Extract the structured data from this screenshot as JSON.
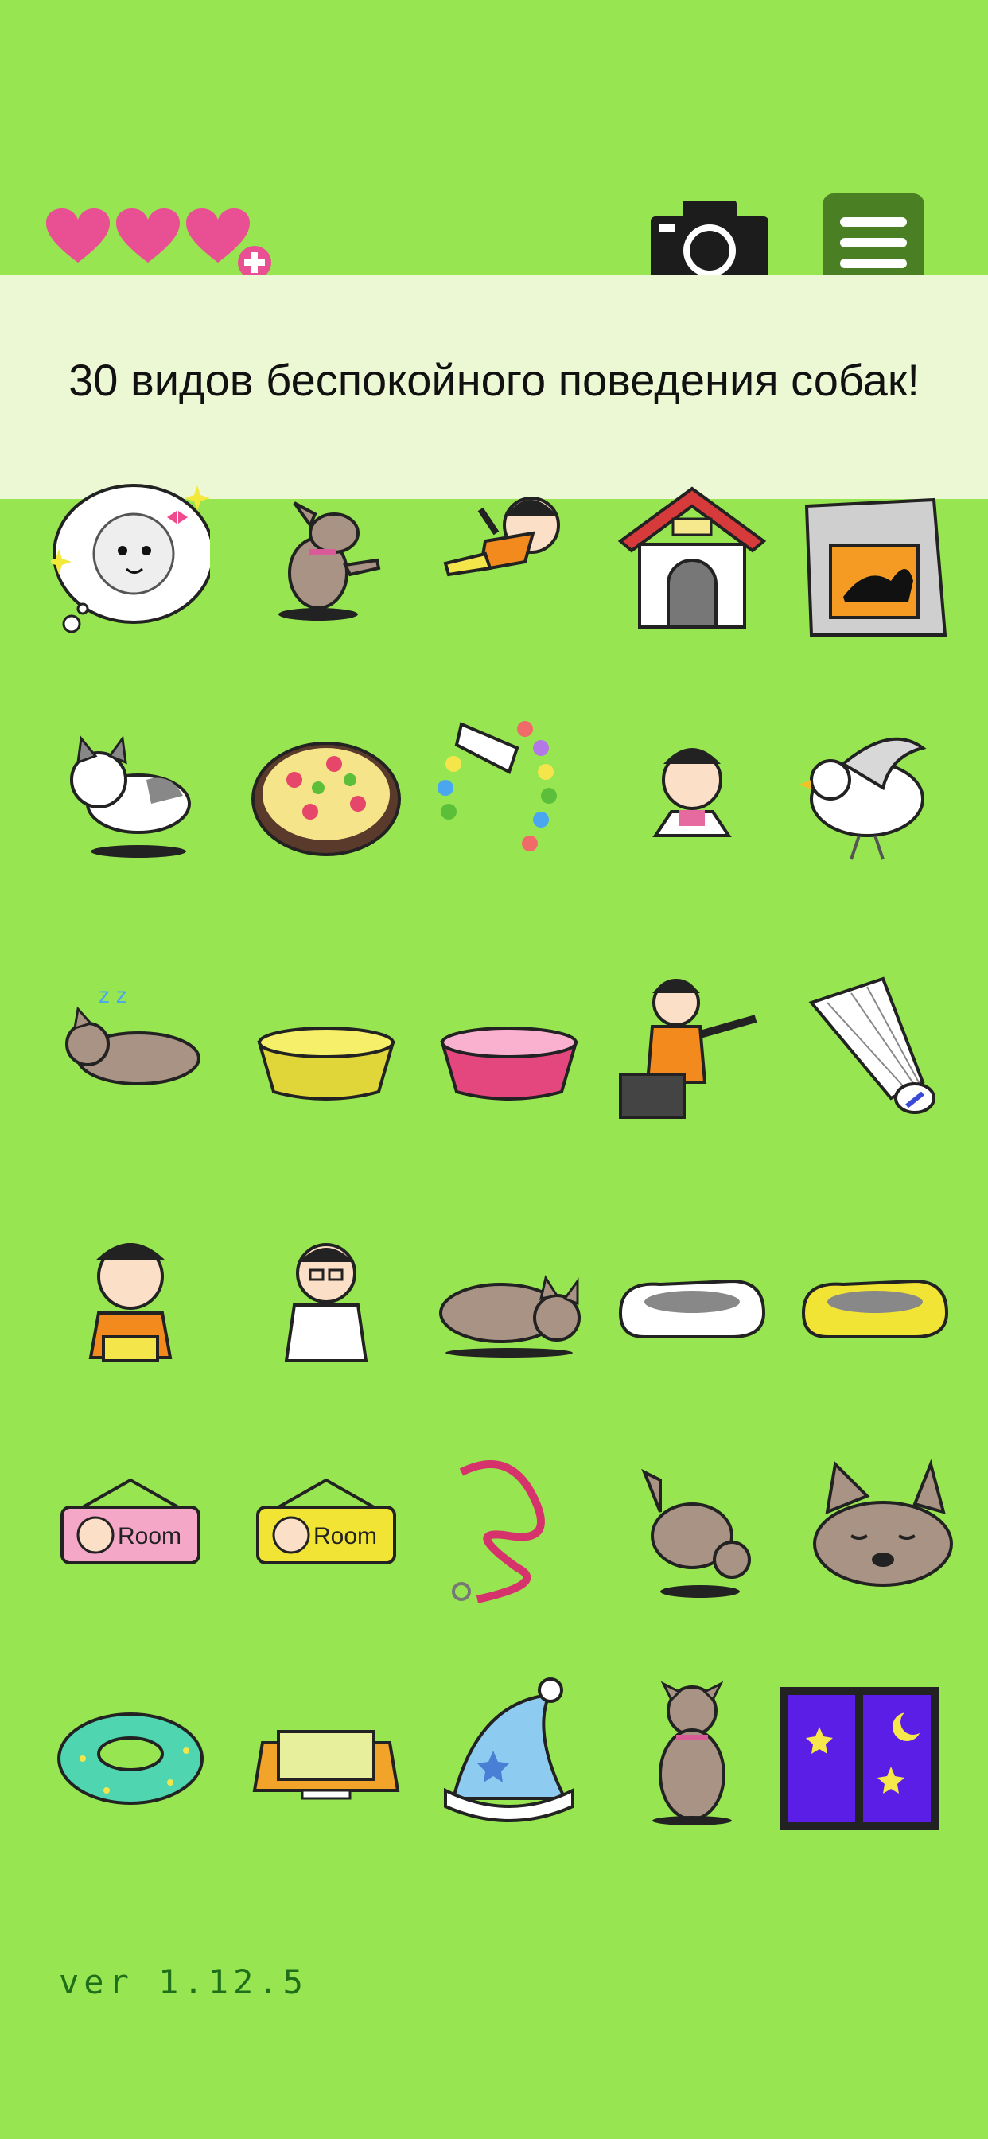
{
  "header": {
    "lives_count": 3,
    "add_life_icon": "plus-icon",
    "camera_icon": "camera-icon",
    "menu_icon": "hamburger-menu-icon",
    "heart_color": "#e94f93",
    "menu_color": "#4a7f24"
  },
  "banner": {
    "text": "30 видов беспокойного поведения собак!",
    "background": "#ecf7d4"
  },
  "items": [
    "dog-dream-thought-icon",
    "dog-begging-icon",
    "girl-flying-icon",
    "dog-house-icon",
    "dog-food-bag-icon",
    "cat-icon",
    "pizza-icon",
    "balloon-number-icon",
    "child-peek-icon",
    "dove-icon",
    "dog-sleeping-zzz-icon",
    "yellow-bowl-icon",
    "pink-bowl-icon",
    "girl-pointing-box-icon",
    "shuttlecock-icon",
    "girl-sitting-icon",
    "man-sitting-icon",
    "dog-lying-icon",
    "white-sneaker-icon",
    "yellow-sneaker-icon",
    "pink-room-sign-icon",
    "yellow-room-sign-icon",
    "leash-icon",
    "dog-digging-icon",
    "dog-face-resting-icon",
    "swim-ring-icon",
    "pet-bed-icon",
    "nightcap-icon",
    "dog-sitting-icon",
    "night-window-icon"
  ],
  "footer": {
    "version": "ver 1.12.5"
  },
  "colors": {
    "background": "#97e651",
    "version_text": "#1f6e1a"
  }
}
